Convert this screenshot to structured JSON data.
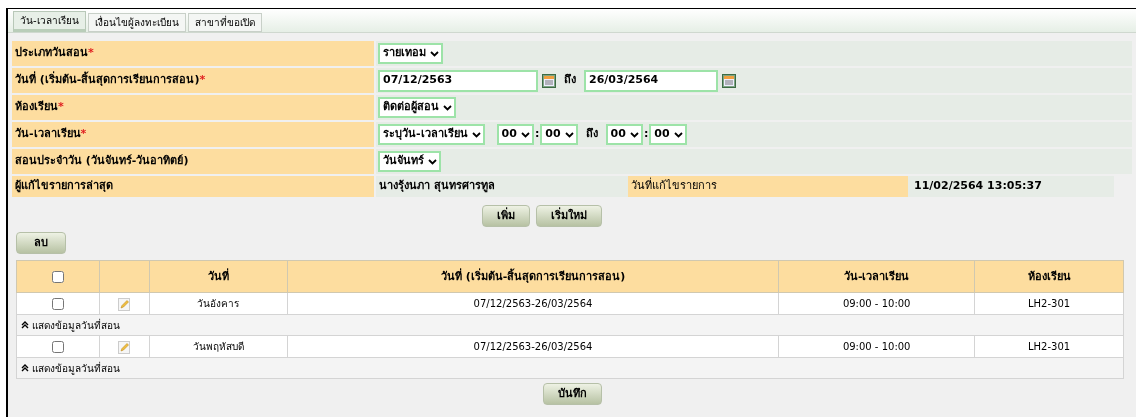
{
  "tabs": [
    {
      "label": "วัน-เวลาเรียน",
      "selected": true
    },
    {
      "label": "เงื่อนไขผู้ลงทะเบียน",
      "selected": false
    },
    {
      "label": "สาขาที่ขอเปิด",
      "selected": false
    }
  ],
  "form": {
    "rows": [
      {
        "kind": "select",
        "label": "ประเภทวันสอน",
        "required_mark": "*",
        "value": "รายเทอม"
      },
      {
        "kind": "date_range",
        "label": "วันที่ (เริ่มต้น-สิ้นสุดการเรียนการสอน)",
        "required_mark": "*",
        "start": "07/12/2563",
        "separator": "ถึง",
        "end": "26/03/2564"
      },
      {
        "kind": "select",
        "label": "ห้องเรียน",
        "required_mark": "*",
        "value": "ติดต่อผู้สอน"
      },
      {
        "kind": "time_range",
        "label": "วัน-เวลาเรียน",
        "required_mark": "*",
        "day_select": "ระบุวัน-เวลาเรียน",
        "start": {
          "hour": "00",
          "colon": ":",
          "minute": "00"
        },
        "separator": "ถึง",
        "end": {
          "hour": "00",
          "colon": ":",
          "minute": "00"
        }
      },
      {
        "kind": "select",
        "label": "สอนประจำวัน (วันจันทร์-วันอาทิตย์)",
        "value": "วันจันทร์"
      }
    ],
    "last_edit": {
      "editor_label": "ผู้แก้ไขรายการล่าสุด",
      "editor": "นางรุ้งนภา สุนทรศารทูล",
      "date_label": "วันที่แก้ไขรายการ",
      "date": "11/02/2564 13:05:37"
    },
    "buttons": [
      "เพิ่ม",
      "เริ่มใหม่"
    ]
  },
  "delete_button": "ลบ",
  "table": {
    "select_all_checked": false,
    "columns": [
      "วันที่",
      "วันที่ (เริ่มต้น-สิ้นสุดการเรียนการสอน)",
      "วัน-เวลาเรียน",
      "ห้องเรียน"
    ],
    "rows": [
      {
        "checked": false,
        "day": "วันอังคาร",
        "date_range": "07/12/2563-26/03/2564",
        "time": "09:00 - 10:00",
        "room": "LH2-301",
        "details_toggle": "แสดงข้อมูลวันที่สอน"
      },
      {
        "checked": false,
        "day": "วันพฤหัสบดี",
        "date_range": "07/12/2563-26/03/2564",
        "time": "09:00 - 10:00",
        "room": "LH2-301",
        "details_toggle": "แสดงข้อมูลวันที่สอน"
      }
    ]
  },
  "save_button": "บันทึก"
}
